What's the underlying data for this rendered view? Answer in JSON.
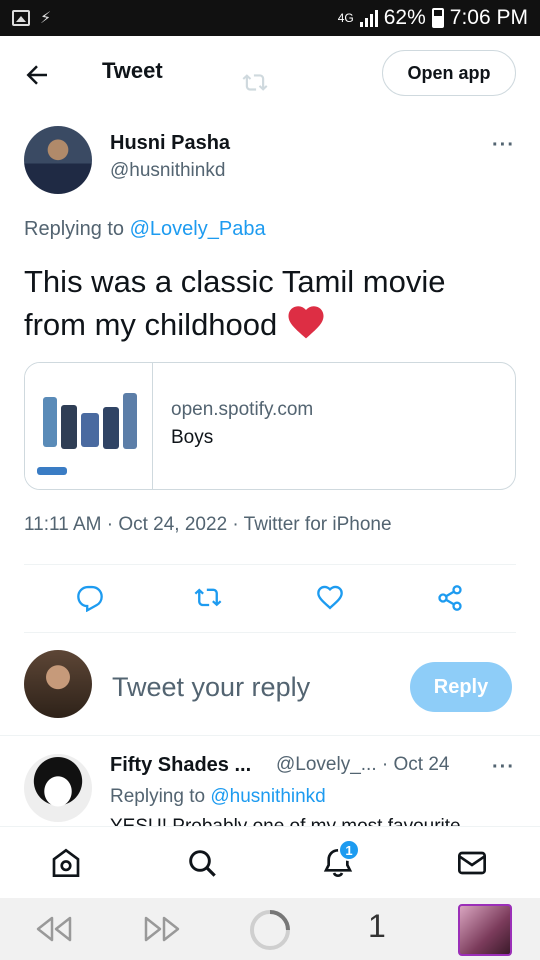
{
  "status_bar": {
    "network": "4G",
    "battery": "62%",
    "time": "7:06 PM"
  },
  "header": {
    "title": "Tweet",
    "open_app_label": "Open app"
  },
  "tweet": {
    "author_name": "Husni Pasha",
    "author_handle": "@husnithinkd",
    "replying_prefix": "Replying to",
    "replying_to": "@Lovely_Paba",
    "text": "This was a classic Tamil movie from my childhood",
    "emoji": "red-heart",
    "card": {
      "domain": "open.spotify.com",
      "title": "Boys"
    },
    "timestamp": "11:11 AM · Oct 24, 2022 · Twitter for iPhone",
    "actions": [
      "reply-icon",
      "retweet-icon",
      "like-icon",
      "share-icon"
    ]
  },
  "reply_box": {
    "placeholder": "Tweet your reply",
    "button_label": "Reply"
  },
  "reply_tweet": {
    "author_name": "Fifty Shades ...",
    "meta": "@Lovely_... · Oct 24",
    "replying_prefix": "Replying to",
    "replying_to": "@husnithinkd",
    "text": "YESU! Probably one of my most favourite"
  },
  "bottom_nav": {
    "items": [
      "home-icon",
      "search-icon",
      "notifications-icon",
      "messages-icon"
    ],
    "notification_count": "1"
  },
  "browser_bar": {
    "tab_count": "1"
  },
  "colors": {
    "accent": "#1d9bf0",
    "reply_button": "#8ecdf8",
    "text_secondary": "#536471",
    "heart": "#e0245e"
  }
}
